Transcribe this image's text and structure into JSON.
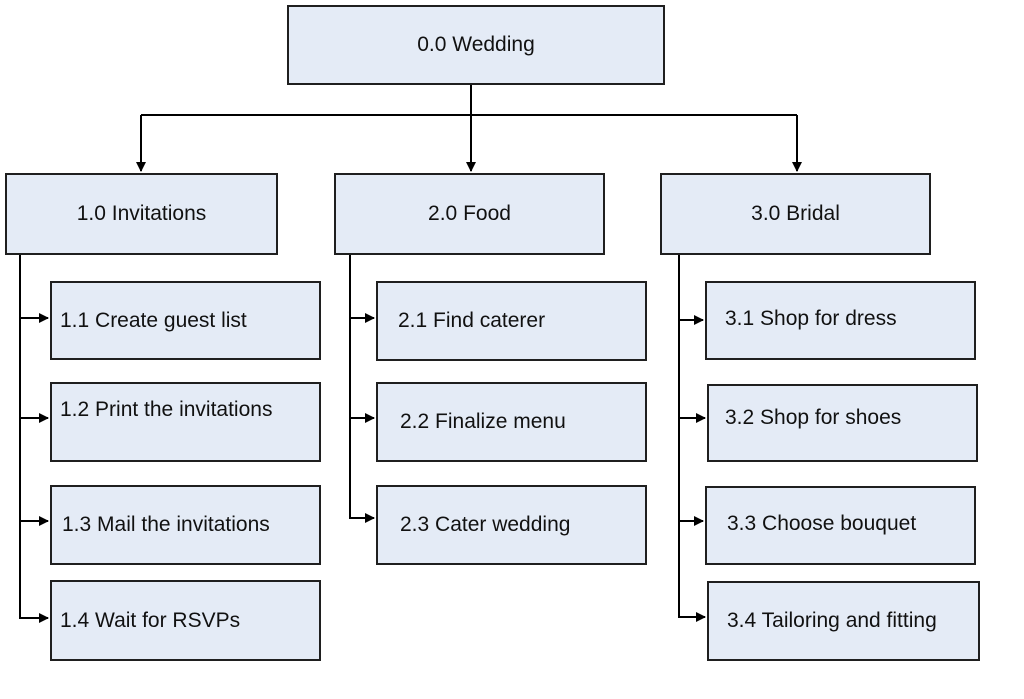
{
  "diagram": {
    "type": "work-breakdown-structure",
    "colors": {
      "box_fill": "#e4ebf6",
      "box_border": "#1f1f1f",
      "connector": "#000000",
      "text": "#111111"
    },
    "root": {
      "id": "0.0",
      "label": "0.0 Wedding"
    },
    "branches": [
      {
        "id": "1.0",
        "label": "1.0 Invitations",
        "children": [
          {
            "id": "1.1",
            "label": "1.1 Create guest list"
          },
          {
            "id": "1.2",
            "label": "1.2 Print the invitations"
          },
          {
            "id": "1.3",
            "label": "1.3 Mail the invitations"
          },
          {
            "id": "1.4",
            "label": "1.4 Wait for RSVPs"
          }
        ]
      },
      {
        "id": "2.0",
        "label": "2.0 Food",
        "children": [
          {
            "id": "2.1",
            "label": "2.1 Find caterer"
          },
          {
            "id": "2.2",
            "label": "2.2 Finalize menu"
          },
          {
            "id": "2.3",
            "label": "2.3 Cater wedding"
          }
        ]
      },
      {
        "id": "3.0",
        "label": "3.0 Bridal",
        "children": [
          {
            "id": "3.1",
            "label": "3.1 Shop for dress"
          },
          {
            "id": "3.2",
            "label": "3.2 Shop for shoes"
          },
          {
            "id": "3.3",
            "label": "3.3 Choose bouquet"
          },
          {
            "id": "3.4",
            "label": "3.4 Tailoring and fitting"
          }
        ]
      }
    ]
  }
}
